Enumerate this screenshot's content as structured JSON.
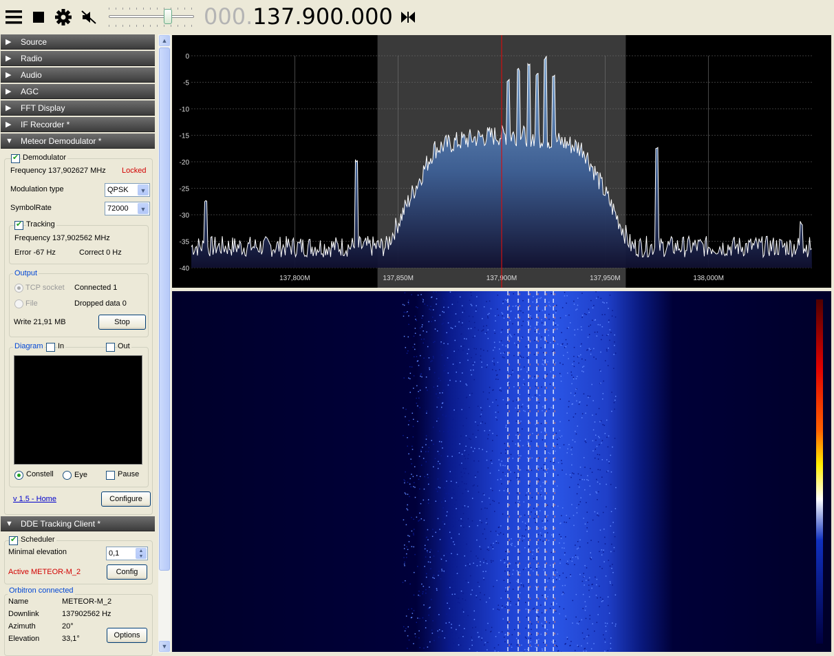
{
  "toolbar": {
    "freq_dim": "000.",
    "freq_main": "137.900.000"
  },
  "panels": {
    "source": "Source",
    "radio": "Radio",
    "audio": "Audio",
    "agc": "AGC",
    "fft": "FFT Display",
    "ifrec": "IF Recorder *",
    "meteor": "Meteor Demodulator *",
    "dde": "DDE Tracking Client *"
  },
  "meteor": {
    "demodulator_label": "Demodulator",
    "frequency": "Frequency 137,902627 MHz",
    "lock_status": "Locked",
    "modulation_label": "Modulation type",
    "modulation_value": "QPSK",
    "symbolrate_label": "SymbolRate",
    "symbolrate_value": "72000",
    "tracking_label": "Tracking",
    "tracking_frequency": "Frequency 137,902562 MHz",
    "error": "Error -67 Hz",
    "correct": "Correct 0 Hz",
    "output_title": "Output",
    "tcp_label": "TCP socket",
    "connected": "Connected 1",
    "file_label": "File",
    "dropped": "Dropped data 0",
    "write": "Write 21,91 MB",
    "stop_btn": "Stop",
    "diagram_title": "Diagram",
    "in_label": "In",
    "out_label": "Out",
    "constell_label": "Constell",
    "eye_label": "Eye",
    "pause_label": "Pause",
    "version_link": "v 1.5 - Home",
    "configure_btn": "Configure"
  },
  "dde": {
    "scheduler_label": "Scheduler",
    "min_elev_label": "Minimal elevation",
    "min_elev_value": "0,1",
    "active": "Active METEOR-M_2",
    "config_btn": "Config",
    "orbitron_title": "Orbitron connected",
    "name_label": "Name",
    "name_value": "METEOR-M_2",
    "downlink_label": "Downlink",
    "downlink_value": "137902562 Hz",
    "azimuth_label": "Azimuth",
    "azimuth_value": "20°",
    "elevation_label": "Elevation",
    "elevation_value": "33,1°",
    "options_btn": "Options"
  },
  "chart_data": {
    "type": "line",
    "title": "",
    "xlabel": "",
    "ylabel": "",
    "y_ticks": [
      "0",
      "-5",
      "-10",
      "-15",
      "-20",
      "-25",
      "-30",
      "-35",
      "-40"
    ],
    "x_ticks": [
      "137,800M",
      "137,850M",
      "137,900M",
      "137,950M",
      "138,000M"
    ],
    "ylim": [
      -40,
      0
    ],
    "xlim_mhz": [
      137.75,
      138.05
    ],
    "center_mhz": 137.9,
    "filter_band_mhz": [
      137.84,
      137.96
    ],
    "noise_floor_db": -36,
    "signal_band_mhz": [
      137.852,
      137.955
    ],
    "signal_peak_db": -15,
    "spikes": [
      {
        "x": 137.757,
        "y": -28
      },
      {
        "x": 137.83,
        "y": -20.5
      },
      {
        "x": 137.903,
        "y": -5
      },
      {
        "x": 137.908,
        "y": -3
      },
      {
        "x": 137.913,
        "y": -2.5
      },
      {
        "x": 137.917,
        "y": -4
      },
      {
        "x": 137.921,
        "y": -1
      },
      {
        "x": 137.925,
        "y": -4
      },
      {
        "x": 137.975,
        "y": -18
      },
      {
        "x": 138.045,
        "y": -32
      }
    ],
    "grid": true
  },
  "colors": {
    "center_line": "#d01010",
    "trace": "#ffffff",
    "fill_top": "#7aa6d6",
    "band_shade": "#3a3a3a"
  }
}
